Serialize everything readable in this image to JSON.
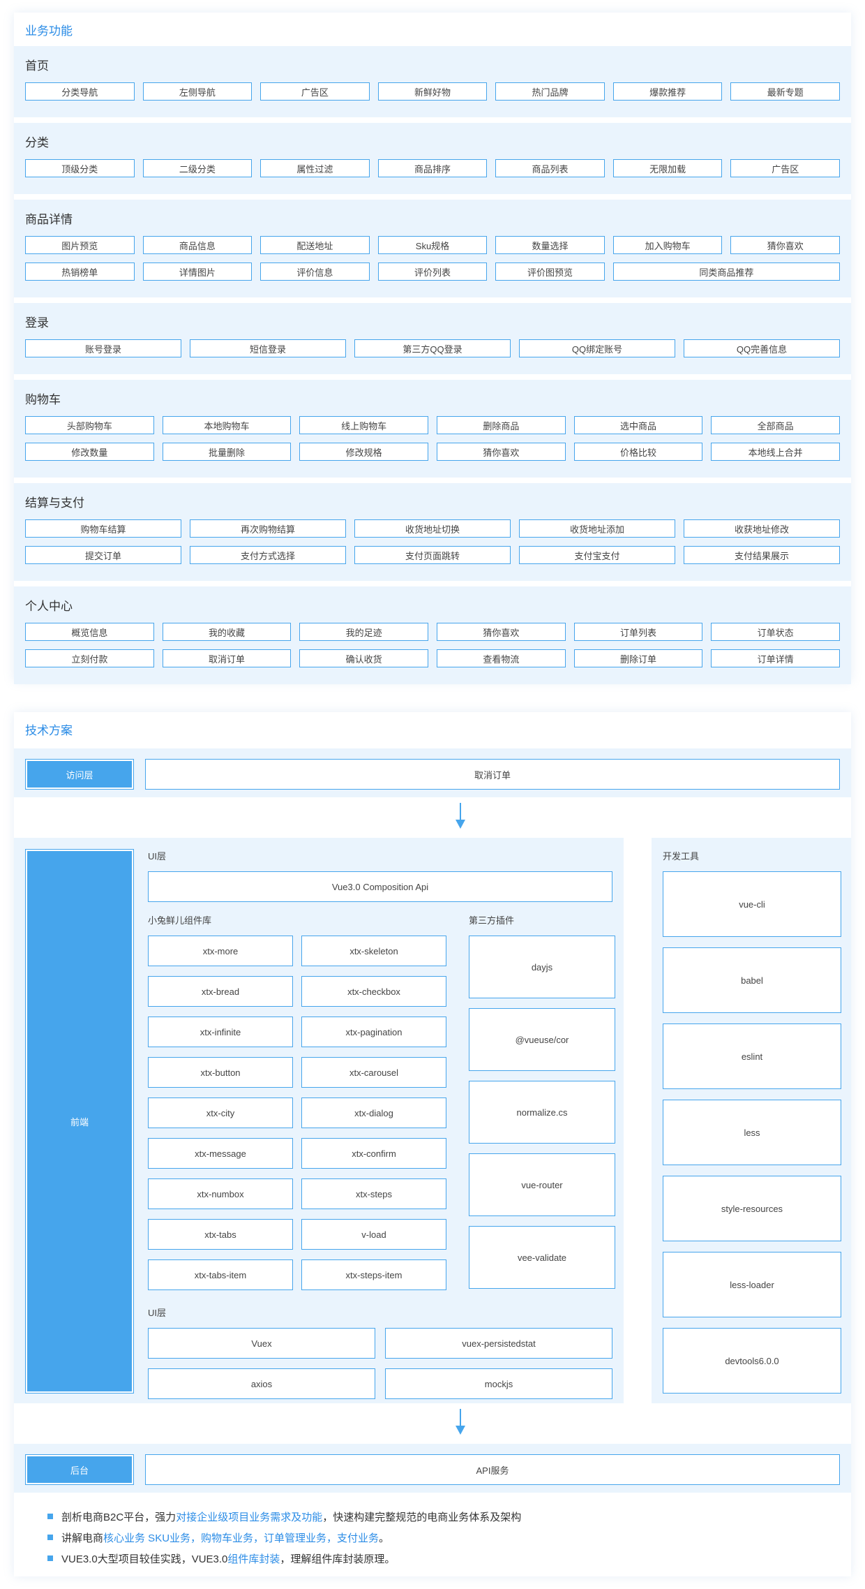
{
  "business": {
    "title": "业务功能",
    "sections": [
      {
        "title": "首页",
        "rows": [
          [
            "分类导航",
            "左侧导航",
            "广告区",
            "新鲜好物",
            "热门品牌",
            "爆款推荐",
            "最新专题"
          ]
        ]
      },
      {
        "title": "分类",
        "rows": [
          [
            "顶级分类",
            "二级分类",
            "属性过滤",
            "商品排序",
            "商品列表",
            "无限加载",
            "广告区"
          ]
        ]
      },
      {
        "title": "商品详情",
        "rows": [
          [
            "图片预览",
            "商品信息",
            "配送地址",
            "Sku规格",
            "数量选择",
            "加入购物车",
            "猜你喜欢"
          ],
          [
            "热销榜单",
            "详情图片",
            "评价信息",
            "评价列表",
            "评价图预览",
            "同类商品推荐"
          ]
        ]
      },
      {
        "title": "登录",
        "rows": [
          [
            "账号登录",
            "短信登录",
            "第三方QQ登录",
            "QQ绑定账号",
            "QQ完善信息"
          ]
        ]
      },
      {
        "title": "购物车",
        "rows": [
          [
            "头部购物车",
            "本地购物车",
            "线上购物车",
            "删除商品",
            "选中商品",
            "全部商品"
          ],
          [
            "修改数量",
            "批量删除",
            "修改规格",
            "猜你喜欢",
            "价格比较",
            "本地线上合并"
          ]
        ]
      },
      {
        "title": "结算与支付",
        "rows": [
          [
            "购物车结算",
            "再次购物结算",
            "收货地址切换",
            "收货地址添加",
            "收获地址修改"
          ],
          [
            "提交订单",
            "支付方式选择",
            "支付页面跳转",
            "支付宝支付",
            "支付结果展示"
          ]
        ]
      },
      {
        "title": "个人中心",
        "rows": [
          [
            "概览信息",
            "我的收藏",
            "我的足迹",
            "猜你喜欢",
            "订单列表",
            "订单状态"
          ],
          [
            "立刻付款",
            "取消订单",
            "确认收货",
            "查看物流",
            "删除订单",
            "订单详情"
          ]
        ]
      }
    ]
  },
  "tech": {
    "title": "技术方案",
    "access_layer": {
      "label": "访问层",
      "content": "取消订单"
    },
    "frontend": {
      "label": "前端",
      "ui_layer_title": "UI层",
      "vue_box": "Vue3.0  Composition Api",
      "component_lib_title": "小兔鲜儿组件库",
      "components": [
        [
          "xtx-more",
          "xtx-skeleton"
        ],
        [
          "xtx-bread",
          "xtx-checkbox"
        ],
        [
          "xtx-infinite",
          "xtx-pagination"
        ],
        [
          "xtx-button",
          "xtx-carousel"
        ],
        [
          "xtx-city",
          "xtx-dialog"
        ],
        [
          "xtx-message",
          "xtx-confirm"
        ],
        [
          "xtx-numbox",
          "xtx-steps"
        ],
        [
          "xtx-tabs",
          "v-load"
        ],
        [
          "xtx-tabs-item",
          "xtx-steps-item"
        ]
      ],
      "plugins_title": "第三方插件",
      "plugins": [
        "dayjs",
        "@vueuse/cor",
        "normalize.cs",
        "vue-router",
        "vee-validate"
      ],
      "state_layer_title": "UI层",
      "state": [
        [
          "Vuex",
          "vuex-persistedstat"
        ],
        [
          "axios",
          "mockjs"
        ]
      ]
    },
    "devtools": {
      "title": "开发工具",
      "items": [
        "vue-cli",
        "babel",
        "eslint",
        "less",
        "style-resources",
        "less-loader",
        "devtools6.0.0"
      ]
    },
    "backend_layer": {
      "label": "后台",
      "content": "API服务"
    },
    "bullets": [
      {
        "pre": "剖析电商B2C平台，强力",
        "hl": "对接企业级项目业务需求及功能",
        "post": "，快速构建完整规范的电商业务体系及架构"
      },
      {
        "pre": "讲解电商",
        "hl": "核心业务 SKU业务，购物车业务，订单管理业务，支付业务",
        "post": "。"
      },
      {
        "pre": "VUE3.0大型项目较佳实践，VUE3.0",
        "hl": "组件库封装",
        "post": "，理解组件库封装原理。"
      }
    ]
  },
  "colors": {
    "accent": "#46a5ec",
    "section_bg": "#eaf4fd",
    "title_blue": "#2b8ce6"
  }
}
